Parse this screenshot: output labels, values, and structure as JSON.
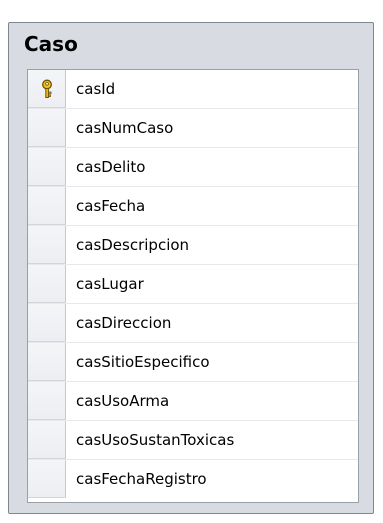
{
  "table": {
    "title": "Caso",
    "columns": [
      {
        "name": "casId",
        "primary_key": true
      },
      {
        "name": "casNumCaso",
        "primary_key": false
      },
      {
        "name": "casDelito",
        "primary_key": false
      },
      {
        "name": "casFecha",
        "primary_key": false
      },
      {
        "name": "casDescripcion",
        "primary_key": false
      },
      {
        "name": "casLugar",
        "primary_key": false
      },
      {
        "name": "casDireccion",
        "primary_key": false
      },
      {
        "name": "casSitioEspecifico",
        "primary_key": false
      },
      {
        "name": "casUsoArma",
        "primary_key": false
      },
      {
        "name": "casUsoSustanToxicas",
        "primary_key": false
      },
      {
        "name": "casFechaRegistro",
        "primary_key": false
      }
    ]
  },
  "icons": {
    "primary_key": "key-icon"
  },
  "colors": {
    "frame": "#d8dce2",
    "key_fill": "#f2c21b"
  }
}
